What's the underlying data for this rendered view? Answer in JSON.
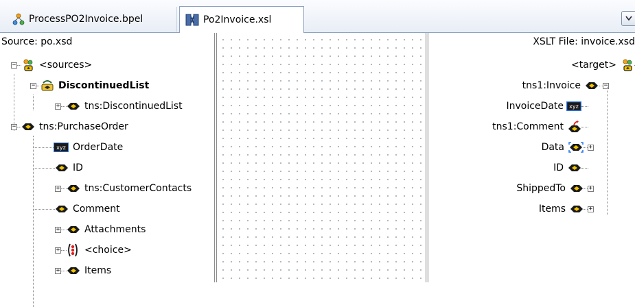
{
  "tabs": [
    {
      "label": "ProcessPO2Invoice.bpel",
      "icon": "bpel-process-icon",
      "active": false
    },
    {
      "label": "Po2Invoice.xsl",
      "icon": "xsl-map-icon",
      "active": true
    }
  ],
  "tab_menu_icon": "dropdown-chevron-icon",
  "source": {
    "header": "Source: po.xsd",
    "rows": [
      {
        "label": "<sources>",
        "icon": "sources-icon",
        "expander": "collapse"
      },
      {
        "label": "DiscontinuedList",
        "icon": "variable-icon",
        "expander": "collapse",
        "bold": true
      },
      {
        "label": "tns:DiscontinuedList",
        "icon": "element-icon",
        "expander": "expand"
      },
      {
        "label": "tns:PurchaseOrder",
        "icon": "element-icon",
        "expander": "collapse"
      },
      {
        "label": "OrderDate",
        "icon": "date-type-icon",
        "expander": "none"
      },
      {
        "label": "ID",
        "icon": "element-icon",
        "expander": "none"
      },
      {
        "label": "tns:CustomerContacts",
        "icon": "element-icon",
        "expander": "expand"
      },
      {
        "label": "Comment",
        "icon": "element-icon",
        "expander": "none"
      },
      {
        "label": "Attachments",
        "icon": "element-icon",
        "expander": "expand"
      },
      {
        "label": "<choice>",
        "icon": "choice-icon",
        "expander": "expand"
      },
      {
        "label": "Items",
        "icon": "element-icon",
        "expander": "expand"
      }
    ]
  },
  "target": {
    "header": "XSLT File: invoice.xsd",
    "rows": [
      {
        "label": "<target>",
        "icon": "target-icon",
        "expander": "collapse"
      },
      {
        "label": "tns1:Invoice",
        "icon": "element-icon",
        "expander": "collapse"
      },
      {
        "label": "InvoiceDate",
        "icon": "date-type-icon",
        "expander": "none"
      },
      {
        "label": "tns1:Comment",
        "icon": "mapped-element-icon",
        "expander": "none"
      },
      {
        "label": "Data",
        "icon": "element-icon",
        "expander": "expand"
      },
      {
        "label": "ID",
        "icon": "element-icon",
        "expander": "none"
      },
      {
        "label": "ShippedTo",
        "icon": "element-icon",
        "expander": "expand"
      },
      {
        "label": "Items",
        "icon": "element-icon",
        "expander": "expand"
      }
    ]
  },
  "colors": {
    "element_icon": "#1a1a1a",
    "element_center": "#f5c400",
    "selection": "#2f7cf6",
    "mapped_arrow": "#e02020"
  }
}
